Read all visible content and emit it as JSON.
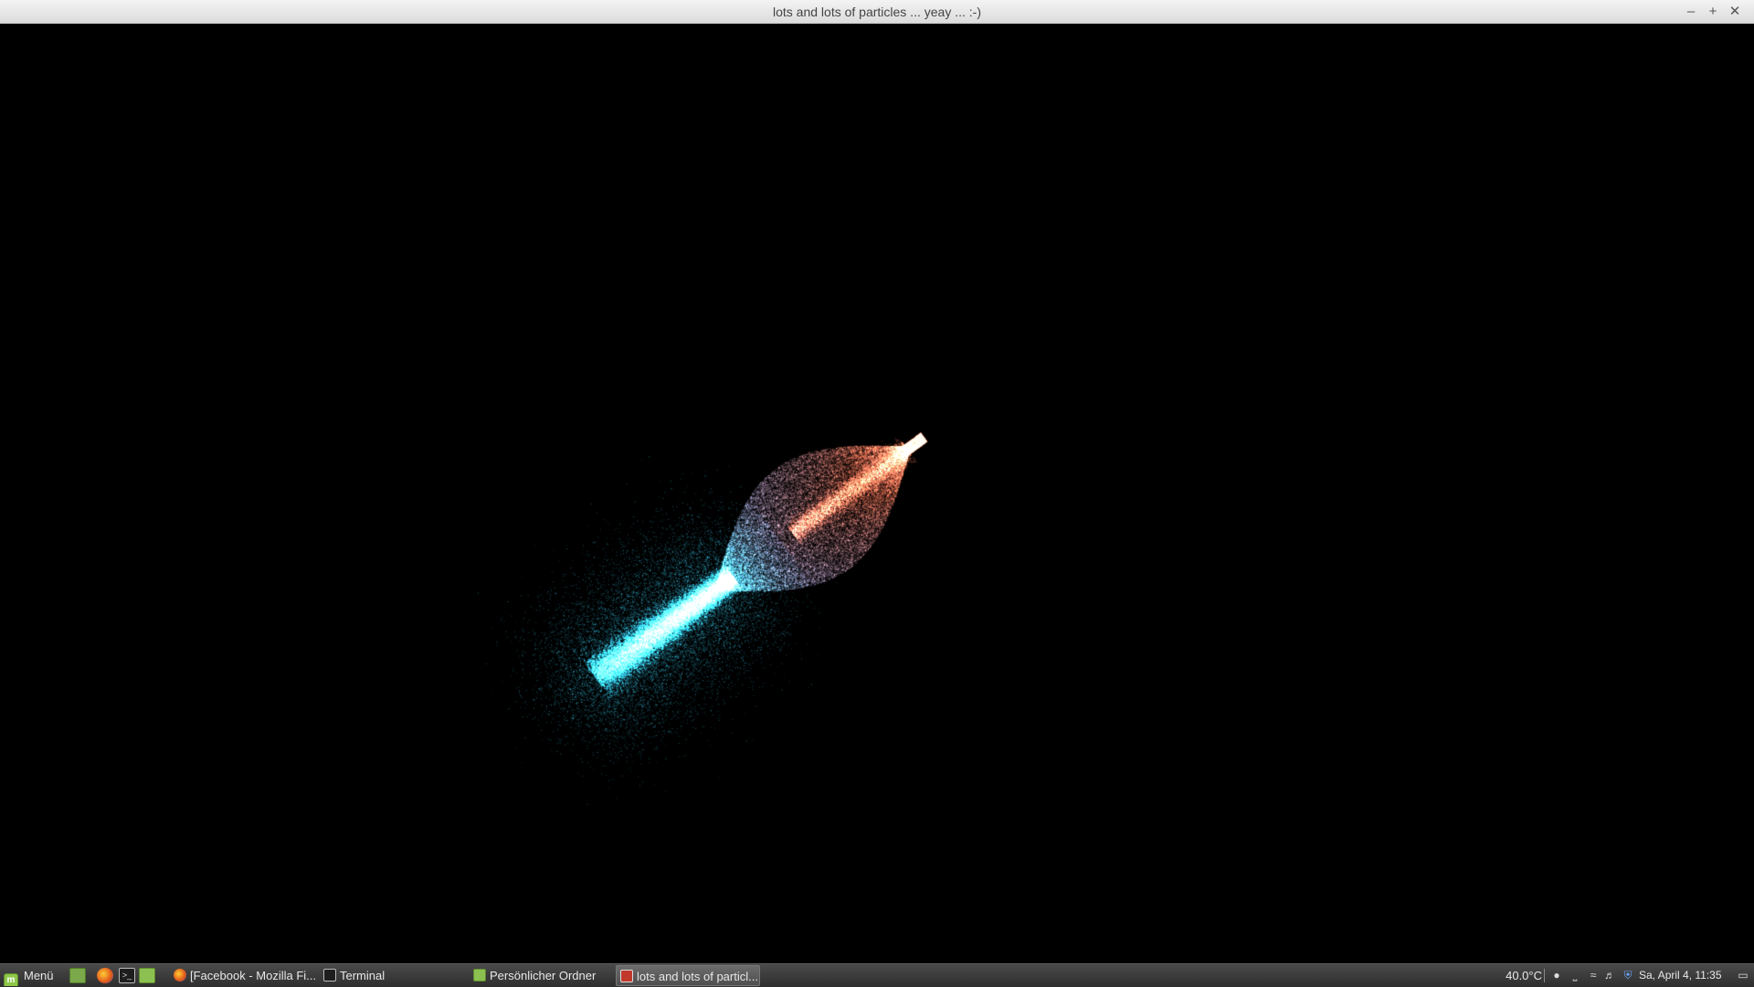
{
  "window": {
    "title": "lots and lots of particles ... yeay ... :-)",
    "controls": {
      "minimize": "–",
      "maximize": "+",
      "close": "✕"
    }
  },
  "taskbar": {
    "menu_label": "Menü",
    "launchers": [
      "show-desktop-icon",
      "firefox-icon",
      "terminal-icon",
      "folder-icon"
    ],
    "tasks": [
      {
        "label": "[Facebook - Mozilla Fi...",
        "icon": "firefox-icon",
        "active": false
      },
      {
        "label": "Terminal",
        "icon": "terminal-icon",
        "active": false
      },
      {
        "label": "Persönlicher Ordner",
        "icon": "folder-icon",
        "active": false
      },
      {
        "label": "lots and lots of particl...",
        "icon": "app-window-icon",
        "active": true
      }
    ],
    "temperature": "40.0°C",
    "clock": "Sa, April  4, 11:35",
    "tray_icons": [
      "user-icon",
      "keyboard-icon",
      "wifi-icon",
      "volume-icon",
      "shield-icon",
      "notification-icon"
    ]
  },
  "colors": {
    "titlebar_bg": "#e6e6e6",
    "canvas_bg": "#000000",
    "particles_tail": "#36d8ff",
    "particles_head": "#ff7a5a",
    "particles_mid": "#c8b8f0",
    "taskbar_bg": "#3a3a3a"
  }
}
